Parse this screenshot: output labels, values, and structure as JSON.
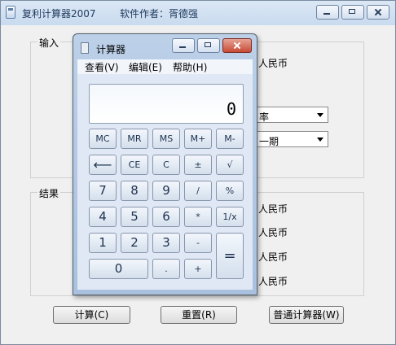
{
  "main": {
    "title": "复利计算器2007",
    "author": "软件作者：胥德强",
    "input_group": {
      "legend": "输入",
      "unit1": "人民币",
      "combo1": "率",
      "combo2": "一期"
    },
    "result_group": {
      "legend": "结果",
      "units": [
        "人民币",
        "人民币",
        "人民币",
        "人民币"
      ]
    },
    "buttons": {
      "calculate": "计算(C)",
      "reset": "重置(R)",
      "normal_calc": "普通计算器(W)"
    }
  },
  "calculator": {
    "title": "计算器",
    "menu": [
      "查看(V)",
      "编辑(E)",
      "帮助(H)"
    ],
    "display": "0",
    "keys": {
      "mc": "MC",
      "mr": "MR",
      "ms": "MS",
      "mplus": "M+",
      "mminus": "M-",
      "back": "⟵",
      "ce": "CE",
      "c": "C",
      "plusminus": "±",
      "sqrt": "√",
      "k7": "7",
      "k8": "8",
      "k9": "9",
      "div": "/",
      "pct": "%",
      "k4": "4",
      "k5": "5",
      "k6": "6",
      "mul": "*",
      "recip": "1/x",
      "k1": "1",
      "k2": "2",
      "k3": "3",
      "sub": "-",
      "eq": "=",
      "k0": "0",
      "dot": ".",
      "add": "+"
    }
  }
}
